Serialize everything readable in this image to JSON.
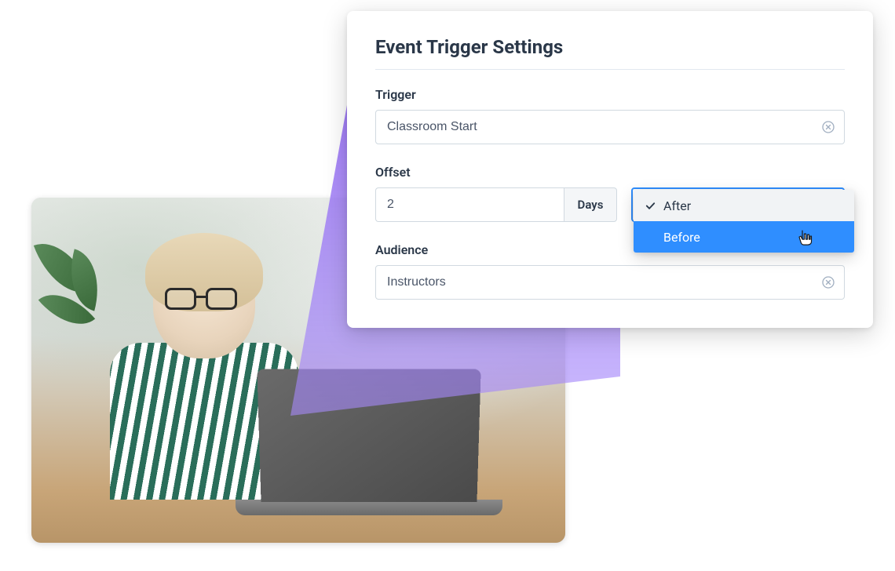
{
  "panel": {
    "title": "Event Trigger Settings",
    "trigger": {
      "label": "Trigger",
      "value": "Classroom Start"
    },
    "offset": {
      "label": "Offset",
      "value": "2",
      "unit": "Days",
      "options": [
        {
          "label": "After",
          "selected": true,
          "highlighted": false
        },
        {
          "label": "Before",
          "selected": false,
          "highlighted": true
        }
      ]
    },
    "audience": {
      "label": "Audience",
      "value": "Instructors"
    }
  },
  "colors": {
    "accent": "#2f8eff",
    "text_dark": "#2a3748",
    "text_mid": "#4a5568",
    "border": "#d1d9e0"
  }
}
